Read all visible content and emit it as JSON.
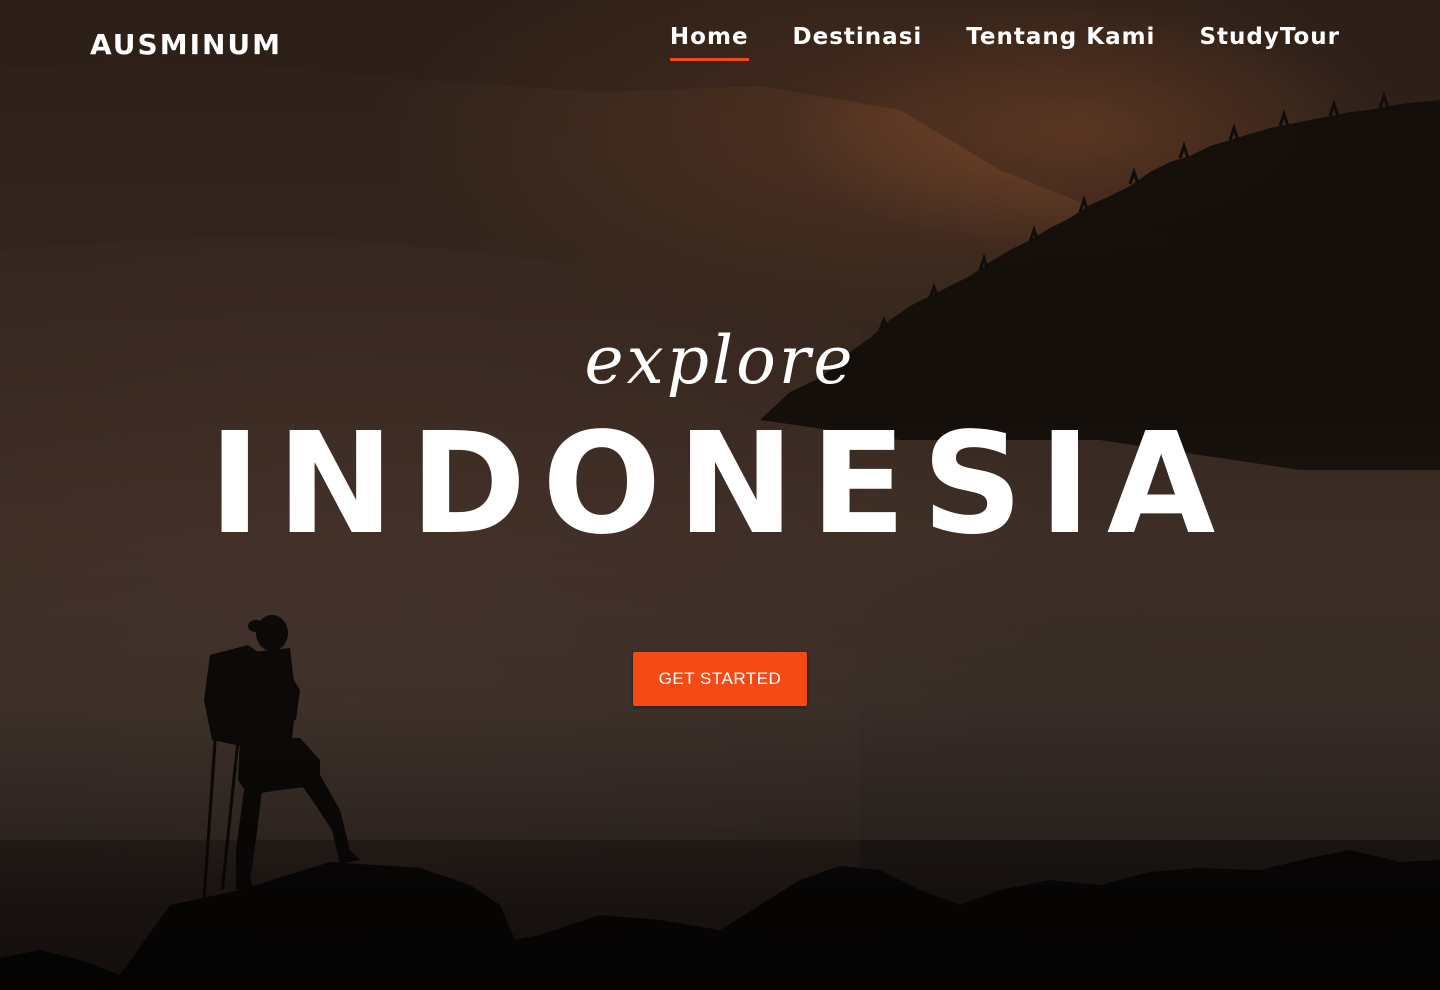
{
  "header": {
    "brand": "AUSMINUM",
    "nav": [
      {
        "label": "Home",
        "active": true
      },
      {
        "label": "Destinasi",
        "active": false
      },
      {
        "label": "Tentang Kami",
        "active": false
      },
      {
        "label": "StudyTour",
        "active": false
      }
    ]
  },
  "hero": {
    "tagline": "explore",
    "headline": "INDONESIA",
    "cta_label": "GET STARTED",
    "background": "hiker silhouette on rocks above misty forested mountains"
  },
  "colors": {
    "accent": "#f54a16",
    "text": "#ffffff",
    "active_underline": "#ee4a1c"
  }
}
